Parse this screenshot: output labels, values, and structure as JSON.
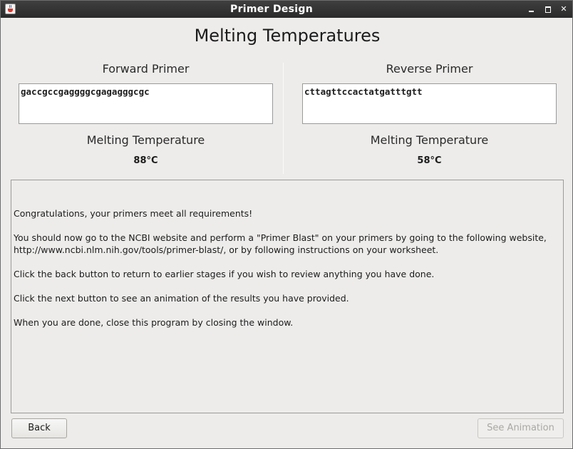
{
  "window": {
    "title": "Primer Design",
    "controls": {
      "minimize": "",
      "maximize": "",
      "close": "✕"
    }
  },
  "heading": "Melting Temperatures",
  "forward": {
    "label": "Forward Primer",
    "sequence": "gaccgccgaggggcgagagggcgc",
    "tm_label": "Melting Temperature",
    "tm_value": "88°C"
  },
  "reverse": {
    "label": "Reverse Primer",
    "sequence": "cttagttccactatgatttgtt",
    "tm_label": "Melting Temperature",
    "tm_value": "58°C"
  },
  "message": {
    "line1": "Congratulations, your primers meet all requirements!",
    "line2": "You should now go to the NCBI website and perform a \"Primer Blast\" on your primers by going to the following website, http://www.ncbi.nlm.nih.gov/tools/primer-blast/, or by following instructions on your worksheet.",
    "line3": "Click the back button to return to earlier stages if you wish to review anything you have done.",
    "line4": "Click the next button to see an animation of the results you have provided.",
    "line5": "When you are done, close this program by closing the window."
  },
  "buttons": {
    "back": "Back",
    "see_animation": "See Animation"
  }
}
